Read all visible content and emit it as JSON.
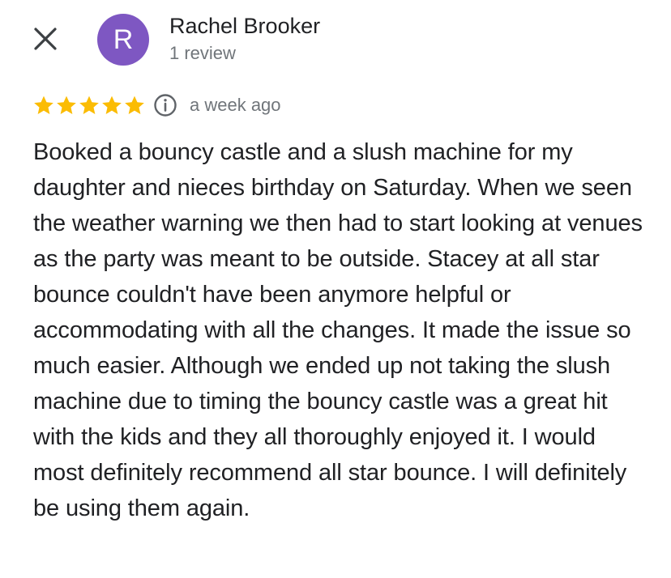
{
  "header": {
    "close_icon": "close-icon",
    "avatar_letter": "R",
    "avatar_color": "#7e57c2",
    "author_name": "Rachel Brooker",
    "review_count": "1 review"
  },
  "rating": {
    "stars": 5,
    "max_stars": 5,
    "star_color": "#fbbc04",
    "info_icon": "info-icon",
    "date": "a week ago"
  },
  "review": {
    "text": "Booked a bouncy castle and a slush machine for my daughter and nieces birthday on Saturday. When we seen the weather warning we then had to start looking at venues as the party was meant to be outside. Stacey at all star bounce couldn't have been anymore helpful or accommodating with all the changes. It made the issue so much easier. Although we ended up not taking the slush machine due to timing the bouncy castle was a great hit with the kids and they all thoroughly enjoyed it. I would most definitely recommend all star bounce. I will definitely be using them again."
  }
}
